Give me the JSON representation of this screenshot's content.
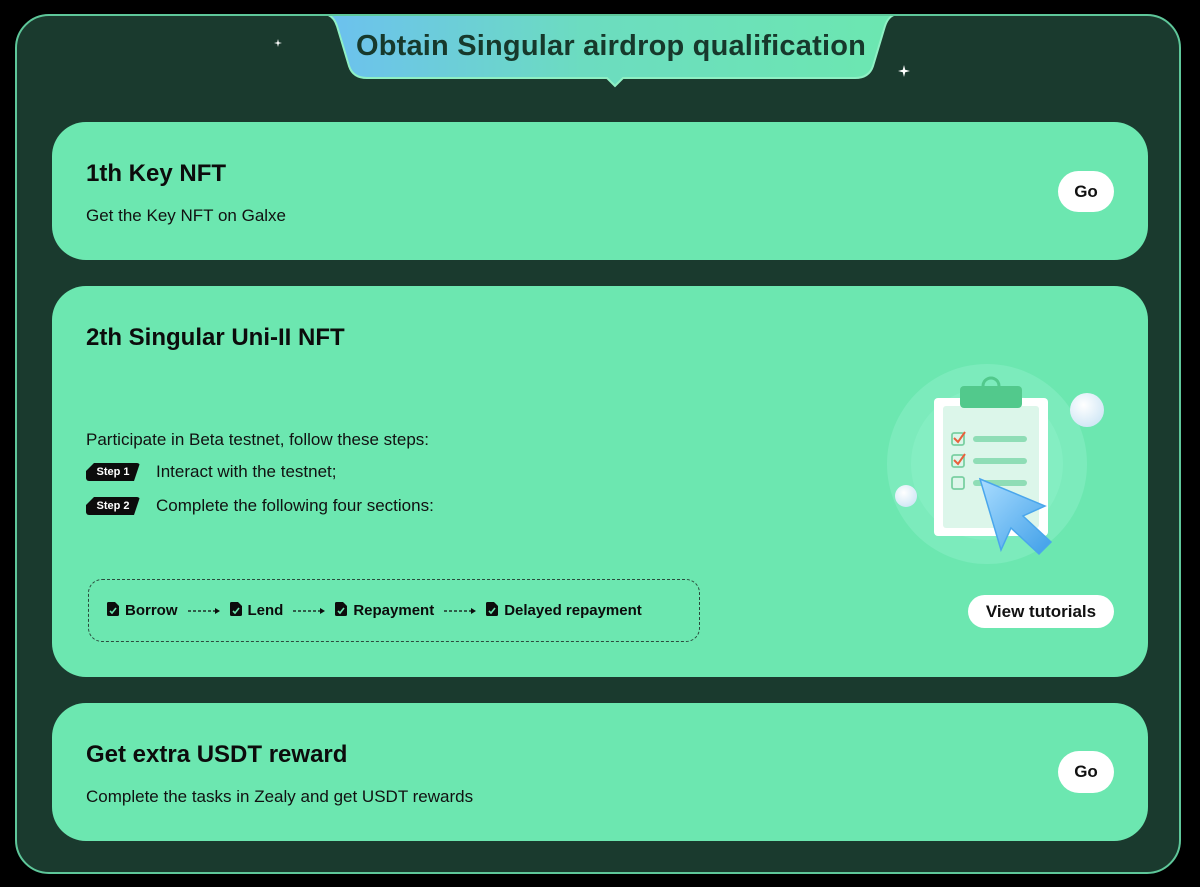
{
  "header": {
    "title": "Obtain Singular airdrop qualification"
  },
  "cards": [
    {
      "title": "1th Key NFT",
      "description": "Get the Key NFT on Galxe",
      "button_label": "Go"
    },
    {
      "title": "2th Singular Uni-II NFT",
      "intro": "Participate in Beta testnet, follow these steps:",
      "steps": [
        {
          "badge": "Step 1",
          "text": "Interact with the testnet;"
        },
        {
          "badge": "Step 2",
          "text": "Complete the following four sections:"
        }
      ],
      "sections": [
        "Borrow",
        "Lend",
        "Repayment",
        "Delayed repayment"
      ],
      "button_label": "View tutorials"
    },
    {
      "title": "Get extra USDT reward",
      "description": "Complete the tasks in Zealy and get USDT rewards",
      "button_label": "Go"
    }
  ],
  "colors": {
    "background": "#000000",
    "panel": "#1a3a2e",
    "panel_border": "#5ec79a",
    "card": "#6ce7b0",
    "title_gradient_start": "#6cc0f0",
    "title_gradient_end": "#6ce7b0",
    "button": "#ffffff",
    "text": "#0c0c0c"
  },
  "icons": {
    "sparkle": "sparkle-icon",
    "document": "document-icon",
    "arrow": "dashed-arrow-icon",
    "illustration": "clipboard-checklist-cursor-illustration"
  }
}
